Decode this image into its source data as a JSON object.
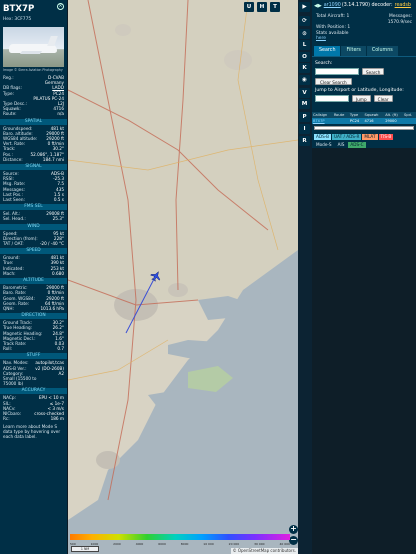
{
  "info": {
    "callsign": "BTX7P",
    "hex_line": "Hex: 3CF775",
    "close_glyph": "×",
    "photo_credit": "Image © Sierra Aviation Photography",
    "basic": [
      {
        "k": "Reg.:",
        "v": "D-CVAB"
      },
      {
        "k": "",
        "v": "Germany"
      },
      {
        "k": "DB flags:",
        "v": "LADD",
        "link": true
      },
      {
        "k": "Type:",
        "v": "PC24"
      },
      {
        "k": "",
        "v": "PILATUS PC-24"
      },
      {
        "k": "Type Desc.:",
        "v": "L2J"
      },
      {
        "k": "Squawk:",
        "v": "4716"
      },
      {
        "k": "Route:",
        "v": "n/a"
      }
    ],
    "sections": [
      {
        "title": "SPATIAL",
        "rows": [
          {
            "k": "Groundspeed:",
            "v": "481 kt"
          },
          {
            "k": "Baro. altitude:",
            "v": "29000 ft"
          },
          {
            "k": "WGS84 altitude:",
            "v": "29200 ft"
          },
          {
            "k": "Vert. Rate:",
            "v": "0 ft/min"
          },
          {
            "k": "Track:",
            "v": "30.2°"
          },
          {
            "k": "Pos.:",
            "v": "52.086°, 1.187°"
          },
          {
            "k": "Distance:",
            "v": "184.7 nmi"
          }
        ]
      },
      {
        "title": "SIGNAL",
        "rows": [
          {
            "k": "Source:",
            "v": "ADS-B"
          },
          {
            "k": "RSSI:",
            "v": "-25.3"
          },
          {
            "k": "Msg. Rate:",
            "v": "7.5"
          },
          {
            "k": "Messages:",
            "v": "435"
          },
          {
            "k": "",
            "v": ""
          },
          {
            "k": "Last Pos.:",
            "v": "1.5 s"
          },
          {
            "k": "Last Seen:",
            "v": "0.5 s"
          }
        ]
      },
      {
        "title": "FMS SEL",
        "rows": [
          {
            "k": "Sel. Alt.:",
            "v": "29008 ft"
          },
          {
            "k": "Sel. Head.:",
            "v": "25.3°"
          }
        ]
      },
      {
        "title": "WIND",
        "rows": [
          {
            "k": "Speed:",
            "v": "95 kt"
          },
          {
            "k": "Direction (from):",
            "v": "228°"
          },
          {
            "k": "TAT / OAT:",
            "v": "-20 / -40 °C"
          }
        ]
      },
      {
        "title": "SPEED",
        "rows": [
          {
            "k": "Ground:",
            "v": "481 kt"
          },
          {
            "k": "True:",
            "v": "390 kt"
          },
          {
            "k": "Indicated:",
            "v": "253 kt"
          },
          {
            "k": "Mach:",
            "v": "0.680"
          }
        ]
      },
      {
        "title": "ALTITUDE",
        "rows": [
          {
            "k": "Barometric:",
            "v": "29000 ft"
          },
          {
            "k": "Baro. Rate:",
            "v": "0 ft/min"
          },
          {
            "k": "Geom. WGS84:",
            "v": "29200 ft"
          },
          {
            "k": "Geom. Rate:",
            "v": "64 ft/min"
          },
          {
            "k": "QNH:",
            "v": "1013.6 hPa"
          }
        ]
      },
      {
        "title": "DIRECTION",
        "rows": [
          {
            "k": "Ground Track:",
            "v": "30.2°"
          },
          {
            "k": "True Heading:",
            "v": "26.2°"
          },
          {
            "k": "Magnetic Heading:",
            "v": "24.8°"
          },
          {
            "k": "Magnetic Decl.:",
            "v": "1.6°"
          },
          {
            "k": "Track Rate:",
            "v": "0.03"
          },
          {
            "k": "Roll:",
            "v": "0.7"
          }
        ]
      },
      {
        "title": "STUFF",
        "rows": [
          {
            "k": "Nav. Modes:",
            "v": "autopilot,tcas"
          },
          {
            "k": "ADS-B Ver.:",
            "v": "v2 (DO-260B)"
          },
          {
            "k": "Category:",
            "v": "A2"
          },
          {
            "k": "Small (15500 to",
            "v": ""
          },
          {
            "k": "75000 lb)",
            "v": ""
          }
        ]
      },
      {
        "title": "ACCURACY",
        "rows": [
          {
            "k": "NACp:",
            "v": "EPU < 10 m"
          },
          {
            "k": "SIL:",
            "v": "≤ 1e-7"
          },
          {
            "k": "NACv:",
            "v": "< 3 m/s"
          },
          {
            "k": "NICbaro:",
            "v": "cross-checked"
          },
          {
            "k": "Rc:",
            "v": "186 m"
          }
        ]
      }
    ],
    "footer": "Learn more about Mode S data type by hovering over each data label."
  },
  "map": {
    "buttons_top": [
      "U",
      "H",
      "T"
    ],
    "zoom_in": "+",
    "zoom_out": "−",
    "colorbar_labels": [
      "500",
      "1000",
      "2000",
      "4000",
      "6000",
      "8000",
      "10 000",
      "20 000",
      "30 000",
      "40 000"
    ],
    "scale": "1 NM",
    "attribution": "© OpenStreetMap contributors."
  },
  "strip": {
    "buttons": [
      "▶",
      "⟳",
      "⊙",
      "L",
      "O",
      "K",
      "◉",
      "V",
      "M",
      "P",
      "I",
      "R"
    ]
  },
  "side": {
    "header_arrows": "◀▶",
    "header_link": "ar1090",
    "header_version": "(3.14.1790) decoder:",
    "header_status": "readsb",
    "stats": {
      "total_label": "Total Aircraft: 1",
      "messages_label": "Messages:",
      "messages_value": "1570.9/sec",
      "with_pos": "With Position: 1",
      "stats_avail": "Stats available",
      "here_link": "here"
    },
    "tabs": [
      "Search",
      "Filters",
      "Columns"
    ],
    "search_label": "Search:",
    "search_button": "Search",
    "clear_search": "Clear Search",
    "jump_label": "Jump to Airport or Latitude, Longitude:",
    "jump_button": "Jump",
    "clear_button": "Clear",
    "table": {
      "headers": [
        "Callsign",
        "Route",
        "Type",
        "Squawk",
        "Alt. (ft)",
        "Spd."
      ],
      "rows": [
        [
          "BTX7P",
          "",
          "PC24",
          "4716",
          "29000",
          ""
        ]
      ]
    },
    "legend": [
      {
        "label": "ADS-B",
        "bg": "#8be1ff",
        "fg": "#001f2f"
      },
      {
        "label": "UAT / ADS-R",
        "bg": "#3fb0c8",
        "fg": "#001f2f"
      },
      {
        "label": "MLAT",
        "bg": "#ff9966",
        "fg": "#001f2f"
      },
      {
        "label": "TIS-B",
        "bg": "#ff4d4d",
        "fg": "#ffffff"
      }
    ],
    "legend2": [
      {
        "label": "Mode-S",
        "bg": "",
        "fg": "#dbe7ee"
      },
      {
        "label": "AIS",
        "bg": "",
        "fg": "#dbe7ee"
      },
      {
        "label": "ADS-C",
        "bg": "#3fa86a",
        "fg": "#001f2f"
      }
    ]
  },
  "colors": {
    "panel_bg": "#002f46",
    "section_bg": "#00587a",
    "track_line": "#3a4fd6",
    "aircraft_marker": "#2d4fe0"
  }
}
